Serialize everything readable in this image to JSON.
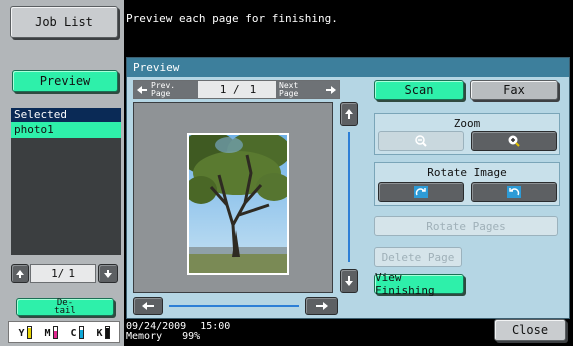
{
  "left": {
    "job_list": "Job List",
    "preview": "Preview",
    "selected_documents_title": "Selected Documents",
    "selected_documents": [
      "photo1"
    ],
    "pager": {
      "current": "1/",
      "total": "1"
    },
    "detail": "De-\ntail",
    "toner": [
      {
        "label": "Y",
        "color": "#e6d400",
        "level": 0.85
      },
      {
        "label": "M",
        "color": "#e0288f",
        "level": 0.6
      },
      {
        "label": "C",
        "color": "#10a8d8",
        "level": 0.7
      },
      {
        "label": "K",
        "color": "#111111",
        "level": 0.9
      }
    ]
  },
  "message": "Preview each page for finishing.",
  "panel": {
    "title": "Preview",
    "prev_page": "Prev.\nPage",
    "next_page": "Next\nPage",
    "page_current": "1 /",
    "page_total": "1",
    "scan": "Scan",
    "fax": "Fax",
    "zoom_title": "Zoom",
    "rotate_image_title": "Rotate Image",
    "rotate_pages": "Rotate Pages",
    "delete_page": "Delete Page",
    "view_finishing": "View Finishing",
    "close": "Close"
  },
  "status": {
    "date": "09/24/2009",
    "time": "15:00",
    "memory_label": "Memory",
    "memory_value": "99%"
  },
  "colors": {
    "accent_green": "#2ef0aa",
    "panel_title_bar": "#3d7f9c",
    "panel_bg": "#b5d6e4"
  }
}
